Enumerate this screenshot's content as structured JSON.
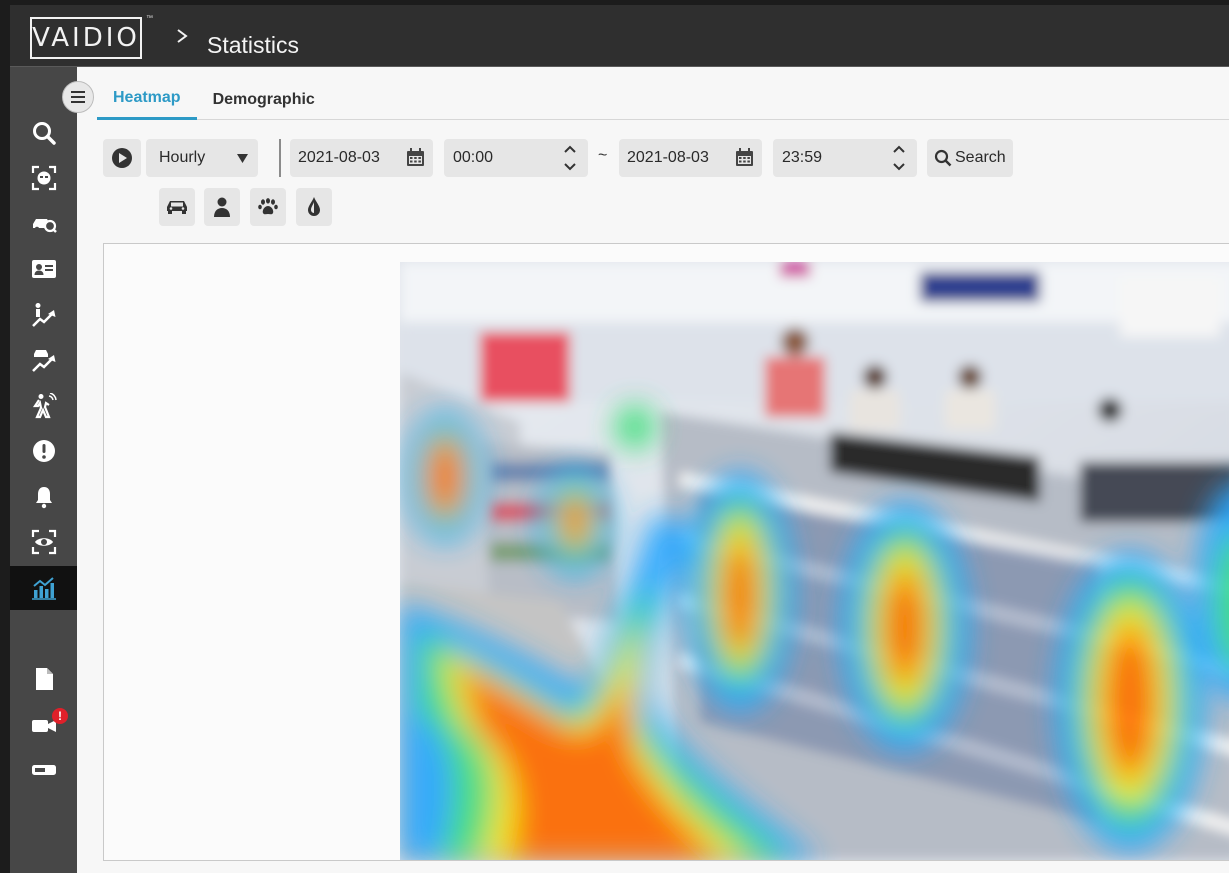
{
  "brand": {
    "logo_text": "VAIDIO",
    "tm": "™"
  },
  "breadcrumb": {
    "title": "Statistics"
  },
  "sidebar": {
    "items": [
      {
        "icon": "search-icon"
      },
      {
        "icon": "face-scan-icon"
      },
      {
        "icon": "vehicle-search-icon"
      },
      {
        "icon": "id-card-icon"
      },
      {
        "icon": "person-trend-icon"
      },
      {
        "icon": "vehicle-trend-icon"
      },
      {
        "icon": "intrusion-icon"
      },
      {
        "icon": "alert-icon"
      },
      {
        "icon": "bell-icon"
      },
      {
        "icon": "eye-scan-icon"
      },
      {
        "icon": "statistics-icon",
        "active": true
      },
      {
        "icon": "report-icon"
      },
      {
        "icon": "camera-icon",
        "badge": "!"
      },
      {
        "icon": "storage-icon"
      }
    ]
  },
  "tabs": [
    {
      "label": "Heatmap",
      "active": true
    },
    {
      "label": "Demographic",
      "active": false
    }
  ],
  "filters": {
    "interval": "Hourly",
    "start_date": "2021-08-03",
    "start_time": "00:00",
    "separator": "~",
    "end_date": "2021-08-03",
    "end_time": "23:59",
    "search_label": "Search"
  },
  "object_filters": [
    {
      "icon": "car-icon"
    },
    {
      "icon": "person-icon"
    },
    {
      "icon": "paw-icon"
    },
    {
      "icon": "droplet-icon"
    }
  ],
  "colors": {
    "accent": "#2d9ac6",
    "topbar": "#2f2f2f",
    "sidebar": "#474747",
    "heat_high": "#ff6a00",
    "heat_mid": "#f5e600",
    "heat_low": "#2aa8ff"
  }
}
